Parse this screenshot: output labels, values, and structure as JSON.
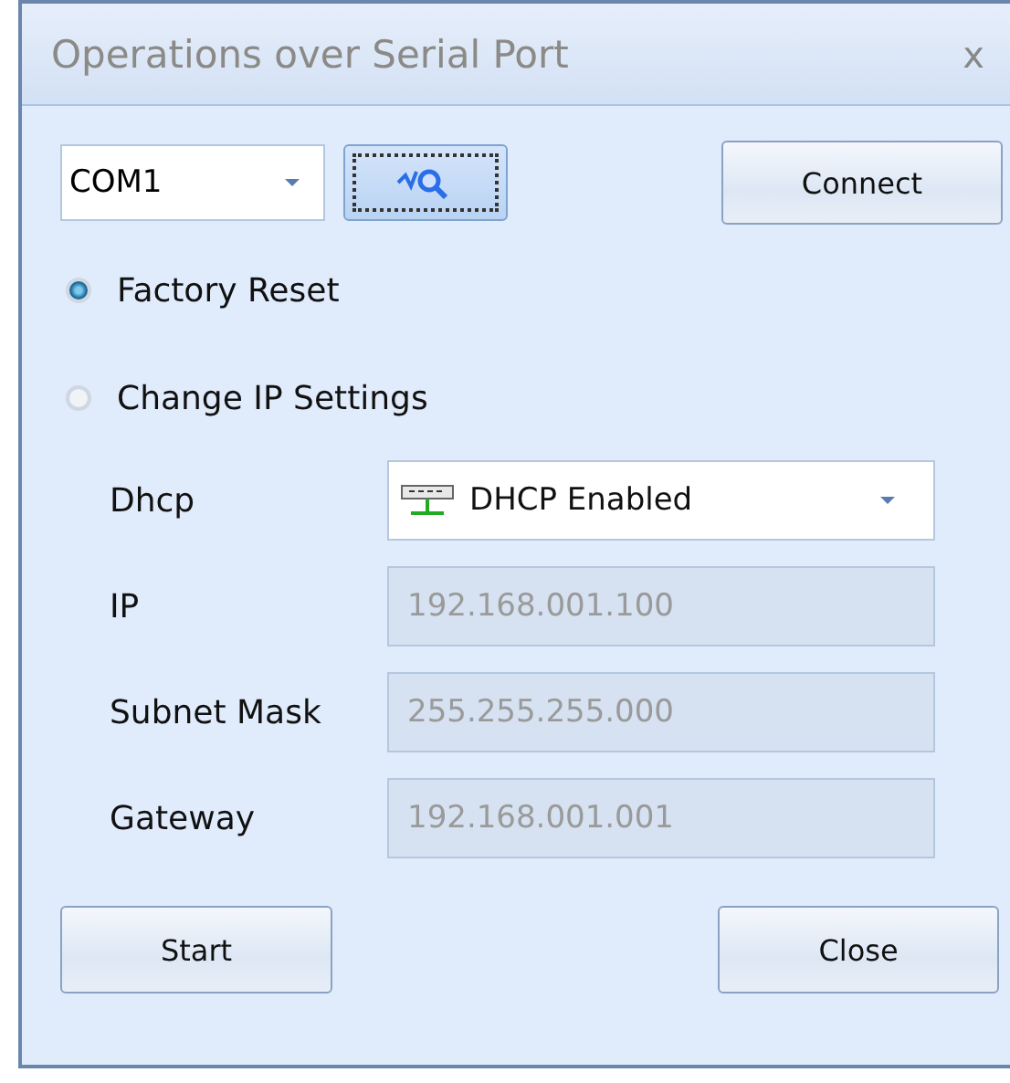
{
  "window": {
    "title": "Operations over Serial Port",
    "close": "x"
  },
  "port": {
    "value": "COM1"
  },
  "connect_button": "Connect",
  "options": [
    {
      "label": "Factory Reset",
      "selected": true
    },
    {
      "label": "Change IP Settings",
      "selected": false
    }
  ],
  "fields": [
    {
      "kind": "dropdown",
      "label": "Dhcp",
      "value": "DHCP Enabled",
      "disabled": false
    },
    {
      "kind": "text",
      "label": "IP",
      "value": "192.168.001.100",
      "disabled": true
    },
    {
      "kind": "text",
      "label": "Subnet Mask",
      "value": "255.255.255.000",
      "disabled": true
    },
    {
      "kind": "text",
      "label": "Gateway",
      "value": "192.168.001.001",
      "disabled": true
    }
  ],
  "buttons": [
    "Start",
    "Close"
  ]
}
